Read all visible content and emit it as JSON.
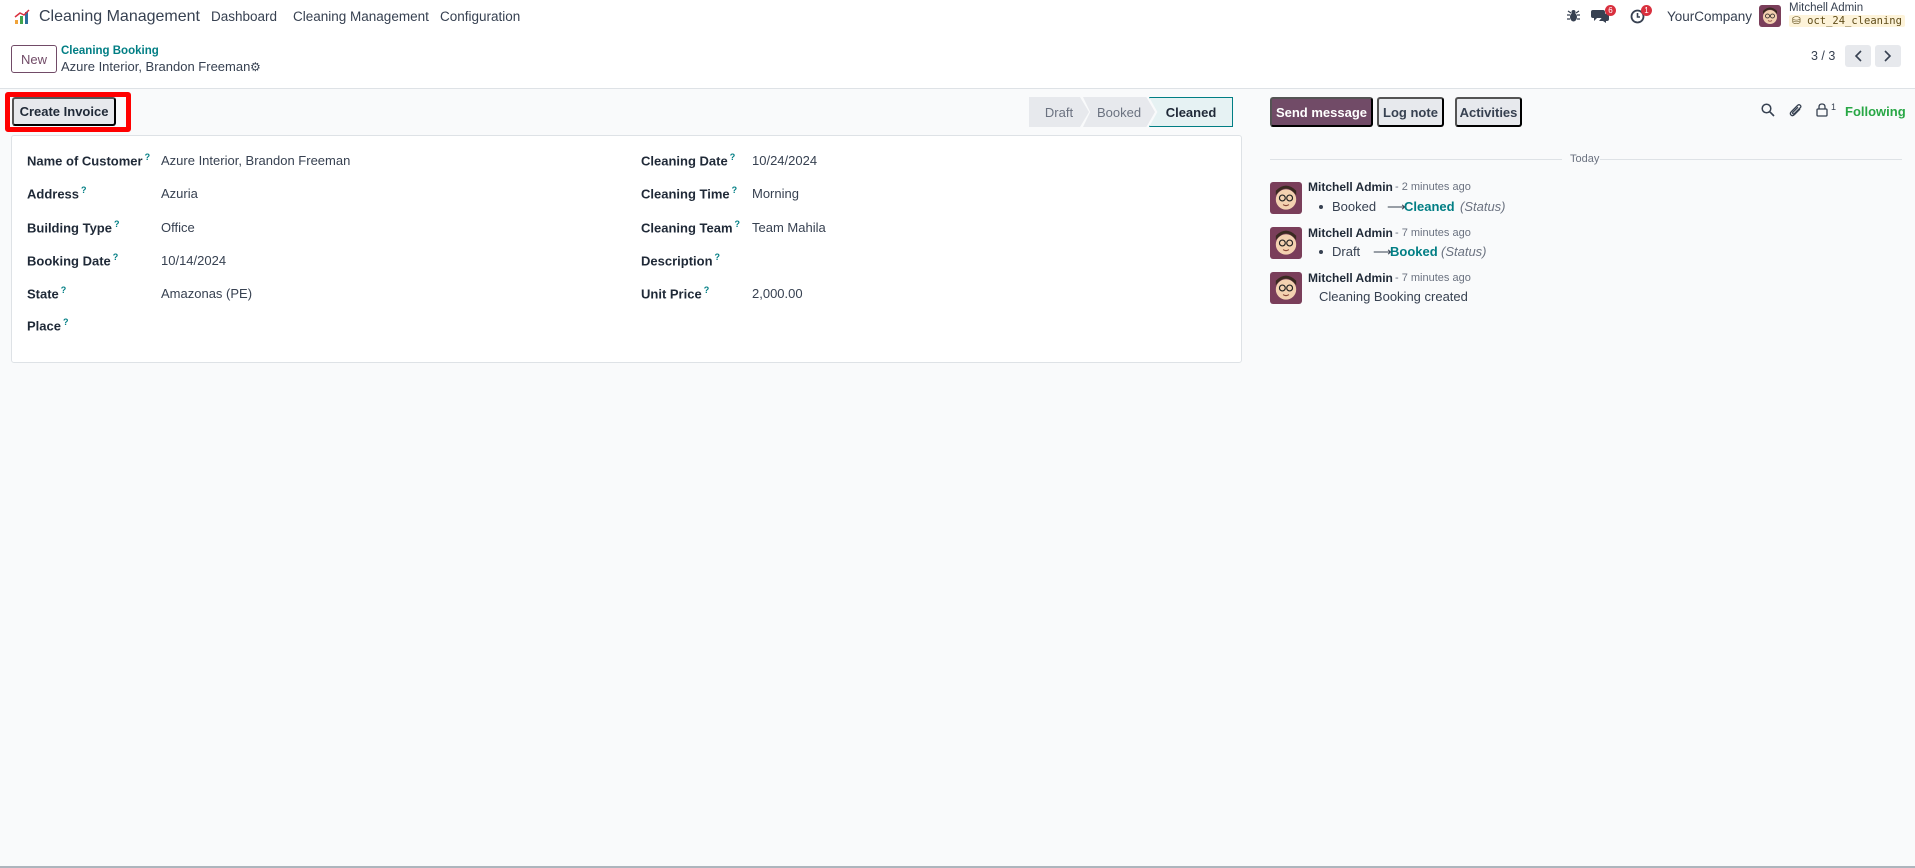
{
  "navbar": {
    "app_name": "Cleaning Management",
    "menu": [
      "Dashboard",
      "Cleaning Management",
      "Configuration"
    ],
    "messages_count": "6",
    "activities_count": "1",
    "company": "YourCompany",
    "user_name": "Mitchell Admin",
    "db_name": "oct_24_cleaning"
  },
  "control": {
    "new_label": "New",
    "breadcrumb_parent": "Cleaning Booking",
    "breadcrumb_current": "Azure Interior, Brandon Freeman",
    "pager": "3 / 3"
  },
  "actions": {
    "create_invoice": "Create Invoice"
  },
  "statusbar": {
    "stages": [
      "Draft",
      "Booked",
      "Cleaned"
    ],
    "active": "Cleaned"
  },
  "form": {
    "left": [
      {
        "label": "Name of Customer",
        "value": "Azure Interior, Brandon Freeman"
      },
      {
        "label": "Address",
        "value": "Azuria"
      },
      {
        "label": "Building Type",
        "value": "Office"
      },
      {
        "label": "Booking Date",
        "value": "10/14/2024"
      },
      {
        "label": "State",
        "value": "Amazonas (PE)"
      },
      {
        "label": "Place",
        "value": ""
      }
    ],
    "right": [
      {
        "label": "Cleaning Date",
        "value": "10/24/2024"
      },
      {
        "label": "Cleaning Time",
        "value": "Morning"
      },
      {
        "label": "Cleaning Team",
        "value": "Team Mahila"
      },
      {
        "label": "Description",
        "value": ""
      },
      {
        "label": "Unit Price",
        "value": "2,000.00"
      }
    ],
    "help_mark": "?"
  },
  "chatter": {
    "send_message": "Send message",
    "log_note": "Log note",
    "activities": "Activities",
    "followers_count": "1",
    "following": "Following",
    "date_separator": "Today",
    "messages": [
      {
        "author": "Mitchell Admin",
        "ago": "- 2 minutes ago",
        "old": "Booked",
        "arrow": "⟶",
        "new": "Cleaned",
        "field": "(Status)"
      },
      {
        "author": "Mitchell Admin",
        "ago": "- 7 minutes ago",
        "old": "Draft",
        "arrow": "⟶",
        "new": "Booked",
        "field": "(Status)"
      },
      {
        "author": "Mitchell Admin",
        "ago": "- 7 minutes ago",
        "body": "Cleaning Booking created"
      }
    ]
  },
  "colors": {
    "brand": "#714b67",
    "link": "#017e84",
    "following": "#28a745",
    "badge": "#d9303e",
    "highlight": "#ff0000"
  }
}
